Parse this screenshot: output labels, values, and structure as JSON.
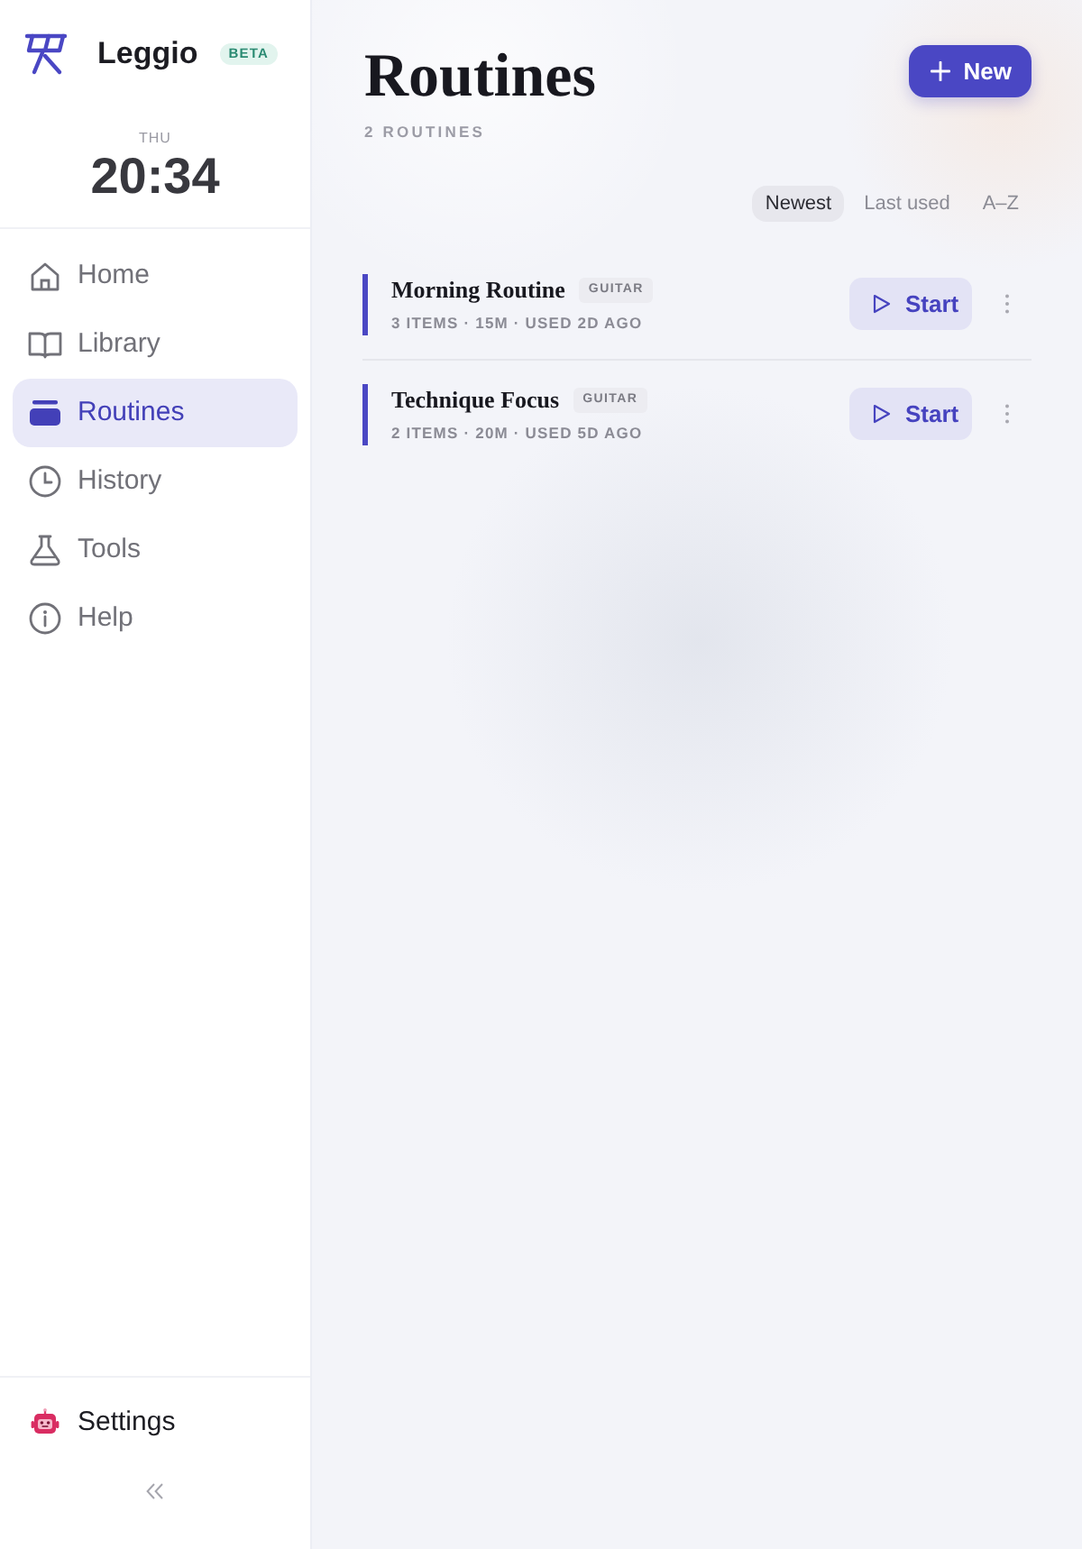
{
  "sidebar": {
    "brand": "Leggio",
    "badge": "BETA",
    "day": "THU",
    "time": "20:34",
    "nav": [
      {
        "label": "Home",
        "selected": false
      },
      {
        "label": "Library",
        "selected": false
      },
      {
        "label": "Routines",
        "selected": true
      },
      {
        "label": "History",
        "selected": false
      },
      {
        "label": "Tools",
        "selected": false
      },
      {
        "label": "Help",
        "selected": false
      }
    ],
    "footer": {
      "label": "Settings"
    }
  },
  "main": {
    "title": "Routines",
    "count": "2 ROUTINES",
    "new_button": "New",
    "sort": [
      {
        "label": "Newest",
        "selected": true
      },
      {
        "label": "Last used",
        "selected": false
      },
      {
        "label": "A–Z",
        "selected": false
      }
    ],
    "routines": [
      {
        "name": "Morning Routine",
        "tag": "GUITAR",
        "meta": "3 ITEMS · 15M · USED 2D AGO",
        "action": "Start"
      },
      {
        "name": "Technique Focus",
        "tag": "GUITAR",
        "meta": "2 ITEMS · 20M · USED 5D AGO",
        "action": "Start"
      }
    ]
  }
}
